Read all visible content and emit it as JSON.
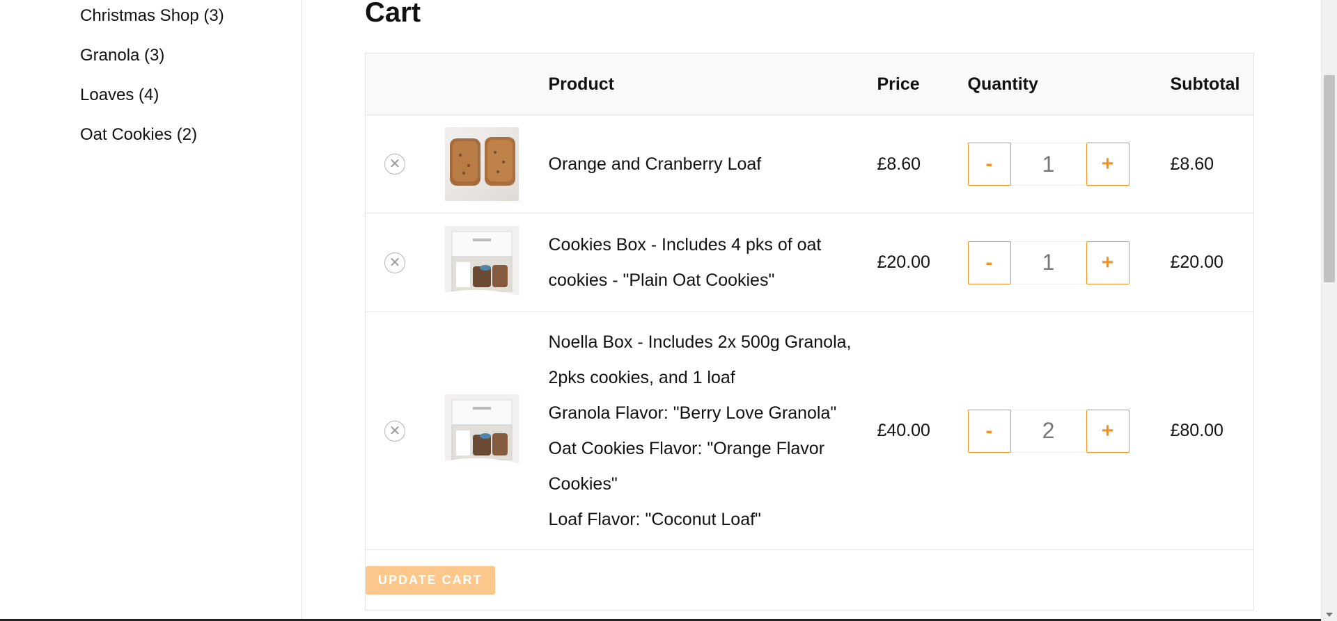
{
  "sidebar": {
    "categories": [
      {
        "label": "Christmas Shop (3)"
      },
      {
        "label": "Granola (3)"
      },
      {
        "label": "Loaves (4)"
      },
      {
        "label": "Oat Cookies (2)"
      }
    ]
  },
  "cart": {
    "title": "Cart",
    "headers": {
      "remove": "",
      "thumb": "",
      "product": "Product",
      "price": "Price",
      "quantity": "Quantity",
      "subtotal": "Subtotal"
    },
    "items": [
      {
        "name": "Orange and Cranberry Loaf",
        "meta": [],
        "price": "£8.60",
        "quantity": "1",
        "subtotal": "£8.60"
      },
      {
        "name": "Cookies Box - Includes 4 pks of oat cookies - \"Plain Oat Cookies\"",
        "meta": [],
        "price": "£20.00",
        "quantity": "1",
        "subtotal": "£20.00"
      },
      {
        "name": "Noella Box - Includes 2x 500g Granola, 2pks cookies, and 1 loaf",
        "meta": [
          "Granola Flavor: \"Berry Love Granola\"",
          "Oat Cookies Flavor: \"Orange Flavor Cookies\"",
          "Loaf Flavor: \"Coconut Loaf\""
        ],
        "price": "£40.00",
        "quantity": "2",
        "subtotal": "£80.00"
      }
    ],
    "controls": {
      "minus": "-",
      "plus": "+",
      "remove_glyph": "✕",
      "update_label": "UPDATE CART"
    }
  },
  "colors": {
    "accent": "#f7931e",
    "update_button_bg": "#fbc78a",
    "border": "#e3e3e3",
    "header_bg": "#f9f9f9"
  },
  "icons": {
    "remove": "close-circle-icon",
    "product_image_loaf": "loaf-product-image",
    "product_image_box": "cookies-box-product-image"
  }
}
